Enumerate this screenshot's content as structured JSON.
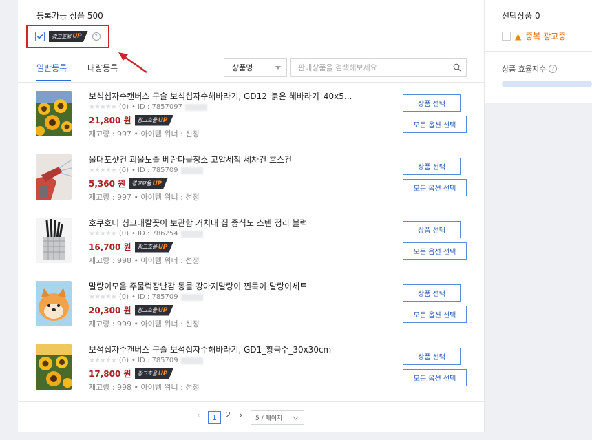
{
  "header": {
    "available_label": "등록가능 상품",
    "available_count": "500",
    "badge_text": "광고효율",
    "badge_up": "UP"
  },
  "tabs": {
    "normal": "일반등록",
    "bulk": "대량등록"
  },
  "search": {
    "select_value": "상품명",
    "placeholder": "판매상품을 검색해보세요"
  },
  "products": [
    {
      "title": "보석십자수캔버스 구슬 보석십자수해바라기, GD12_붉은 해바라기_40x5...",
      "reviews": "(0)",
      "id_text": "• ID : 7857097",
      "price": "21,800 원",
      "stock": "재고량 : 997 • 아이템 위너 : 선정",
      "select_btn": "상품 선택",
      "all_btn": "모든 옵션 선택"
    },
    {
      "title": "물대포샷건 괴물노즐 베란다물청소 고압세척 세차건 호스건",
      "reviews": "(0)",
      "id_text": "• ID : 785709",
      "price": "5,360 원",
      "stock": "재고량 : 997 • 아이템 위너 : 선정",
      "select_btn": "상품 선택",
      "all_btn": "모든 옵션 선택"
    },
    {
      "title": "호쿠호니 싱크대칼꽂이 보관함 거치대 집 중식도 스텐 정리 블럭",
      "reviews": "(0)",
      "id_text": "• ID : 786254",
      "price": "16,700 원",
      "stock": "재고량 : 998 • 아이템 위너 : 선정",
      "select_btn": "상품 선택",
      "all_btn": "모든 옵션 선택"
    },
    {
      "title": "말랑이모음 주물럭장난감 동물 강아지말랑이 찐득이 말랑이세트",
      "reviews": "(0)",
      "id_text": "• ID : 785709",
      "price": "20,300 원",
      "stock": "재고량 : 999 • 아이템 위너 : 선정",
      "select_btn": "상품 선택",
      "all_btn": "모든 옵션 선택"
    },
    {
      "title": "보석십자수캔버스 구슬 보석십자수해바라기, GD1_황금수_30x30cm",
      "reviews": "(0)",
      "id_text": "• ID : 785709",
      "price": "17,800 원",
      "stock": "재고량 : 998 • 아이템 위너 : 선정",
      "select_btn": "상품 선택",
      "all_btn": "모든 옵션 선택"
    }
  ],
  "pagination": {
    "current": "1",
    "next": "2",
    "per_page": "5 / 페이지"
  },
  "right_panel": {
    "selected_label": "선택상품",
    "selected_count": "0",
    "dup_label": "중복 광고중",
    "efficiency_label": "상품 효율지수"
  },
  "colors": {
    "accent": "#2b6cd9",
    "price": "#a82325",
    "highlight_border": "#d0242c",
    "warning": "#e06a17"
  }
}
